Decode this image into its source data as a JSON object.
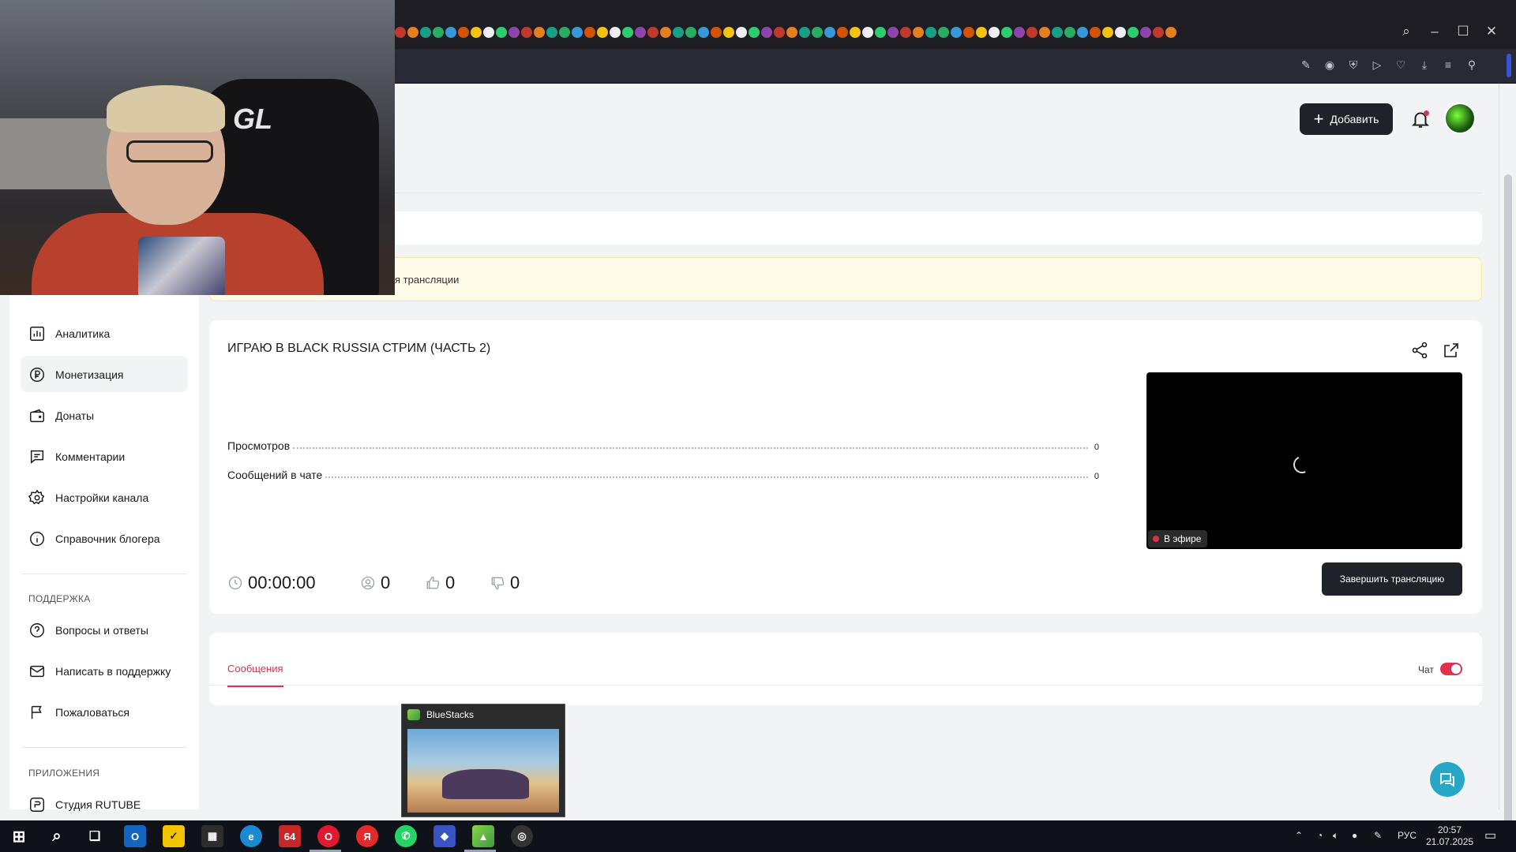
{
  "header": {
    "add_button_label": "Добавить"
  },
  "notice": {
    "text": "я трансляции"
  },
  "sidebar": {
    "items": [
      {
        "label": "Аналитика",
        "icon": "chart-icon"
      },
      {
        "label": "Монетизация",
        "icon": "ruble-icon"
      },
      {
        "label": "Донаты",
        "icon": "wallet-icon"
      },
      {
        "label": "Комментарии",
        "icon": "comment-icon"
      },
      {
        "label": "Настройки канала",
        "icon": "gear-icon"
      },
      {
        "label": "Справочник блогера",
        "icon": "info-icon"
      }
    ],
    "support_section_title": "ПОДДЕРЖКА",
    "support_items": [
      {
        "label": "Вопросы и ответы",
        "icon": "question-icon"
      },
      {
        "label": "Написать в поддержку",
        "icon": "mail-icon"
      },
      {
        "label": "Пожаловаться",
        "icon": "flag-icon"
      }
    ],
    "apps_section_title": "ПРИЛОЖЕНИЯ",
    "apps_items": [
      {
        "label": "Студия RUTUBE",
        "icon": "studio-icon"
      }
    ]
  },
  "stream": {
    "title": "ИГРАЮ В BLACK RUSSIA СТРИМ (ЧАСТЬ 2)",
    "stats": [
      {
        "label": "Просмотров",
        "value": "0"
      },
      {
        "label": "Сообщений в чате",
        "value": "0"
      }
    ],
    "live_badge": "В эфире",
    "duration": "00:00:00",
    "viewers": "0",
    "likes": "0",
    "dislikes": "0",
    "end_button_label": "Завершить трансляцию"
  },
  "chat": {
    "tab_label": "Сообщения",
    "toggle_label": "Чат",
    "toggle_on": true
  },
  "taskbar_preview": {
    "title": "BlueStacks"
  },
  "taskbar": {
    "badge_64": "64",
    "lang": "РУС",
    "time": "20:57",
    "date": "21.07.2025"
  },
  "colors": {
    "accent": "#e0304e",
    "dark_button": "#1f2329",
    "notice_bg": "#fffbe8"
  }
}
